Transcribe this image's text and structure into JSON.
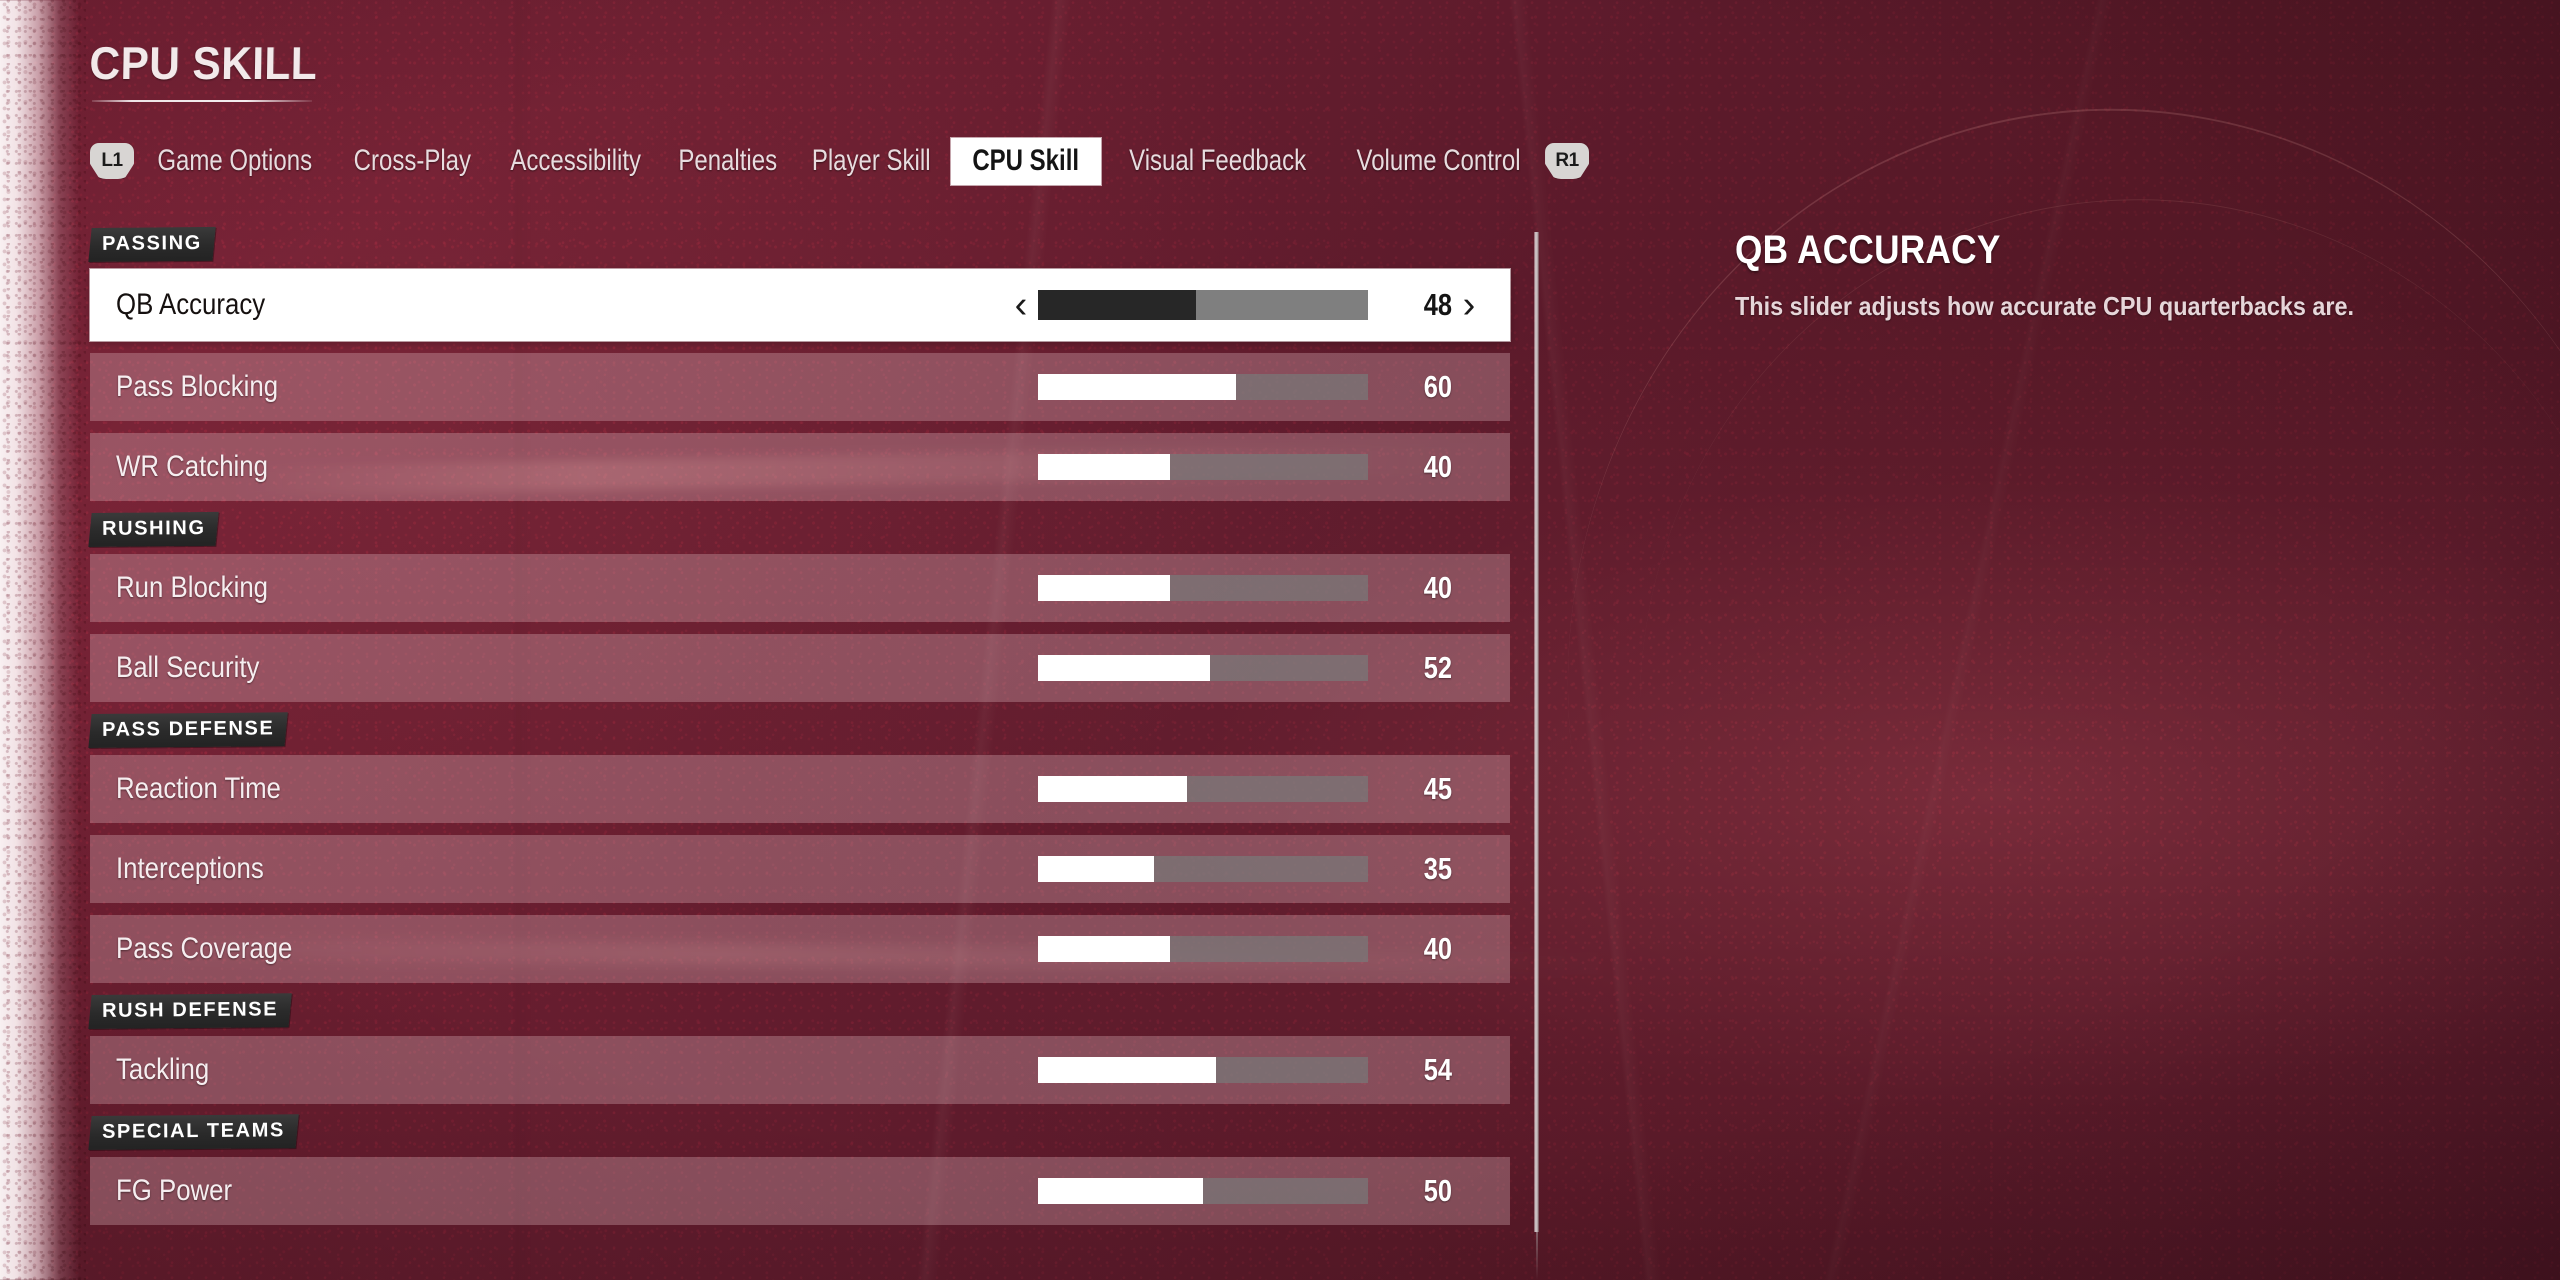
{
  "header": {
    "title": "CPU SKILL",
    "left_bumper": "L1",
    "right_bumper": "R1",
    "tabs": [
      {
        "label": "Game Options",
        "active": false
      },
      {
        "label": "Cross-Play",
        "active": false
      },
      {
        "label": "Accessibility",
        "active": false
      },
      {
        "label": "Penalties",
        "active": false
      },
      {
        "label": "Player Skill",
        "active": false
      },
      {
        "label": "CPU Skill",
        "active": true
      },
      {
        "label": "Visual Feedback",
        "active": false
      },
      {
        "label": "Volume Control",
        "active": false
      }
    ]
  },
  "list": [
    {
      "kind": "section",
      "label": "PASSING"
    },
    {
      "kind": "slider",
      "label": "QB Accuracy",
      "value": 48,
      "selected": true
    },
    {
      "kind": "slider",
      "label": "Pass Blocking",
      "value": 60,
      "selected": false
    },
    {
      "kind": "slider",
      "label": "WR Catching",
      "value": 40,
      "selected": false
    },
    {
      "kind": "section",
      "label": "RUSHING"
    },
    {
      "kind": "slider",
      "label": "Run Blocking",
      "value": 40,
      "selected": false
    },
    {
      "kind": "slider",
      "label": "Ball Security",
      "value": 52,
      "selected": false
    },
    {
      "kind": "section",
      "label": "PASS DEFENSE"
    },
    {
      "kind": "slider",
      "label": "Reaction Time",
      "value": 45,
      "selected": false
    },
    {
      "kind": "slider",
      "label": "Interceptions",
      "value": 35,
      "selected": false
    },
    {
      "kind": "slider",
      "label": "Pass Coverage",
      "value": 40,
      "selected": false
    },
    {
      "kind": "section",
      "label": "RUSH DEFENSE"
    },
    {
      "kind": "slider",
      "label": "Tackling",
      "value": 54,
      "selected": false
    },
    {
      "kind": "section",
      "label": "SPECIAL TEAMS"
    },
    {
      "kind": "slider",
      "label": "FG Power",
      "value": 50,
      "selected": false
    }
  ],
  "detail": {
    "title": "QB ACCURACY",
    "description": "This slider adjusts how accurate CPU quarterbacks are."
  },
  "colors": {
    "background": "#5e1b2c",
    "row_idle": "rgba(231,196,203,0.30)",
    "row_selected": "#ffffff",
    "slider_fill_idle": "#ffffff",
    "slider_track_idle": "rgba(120,120,120,0.72)",
    "slider_fill_selected": "#272727",
    "slider_track_selected": "#7f7f7f",
    "section_header_bg": "#2a2a2a",
    "accent_text": "#ffffff"
  },
  "slider_range": {
    "min": 0,
    "max": 100
  }
}
